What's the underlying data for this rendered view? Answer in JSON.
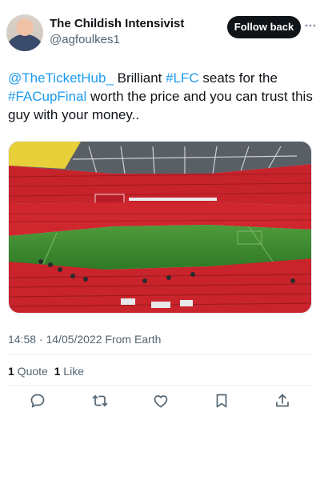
{
  "header": {
    "display_name": "The Childish Intensivist",
    "handle": "@agfoulkes1",
    "follow_label": "Follow back",
    "more_icon": "more-dots-icon"
  },
  "tweet": {
    "mention": "@TheTicketHub_",
    "text_1": " Brilliant ",
    "hashtag_1": "#LFC",
    "text_2": " seats for the ",
    "hashtag_2": "#FACupFinal",
    "text_3": " worth the price and you can trust this guy with your money.."
  },
  "media": {
    "stand_banner": "EMIRATES FA CUP"
  },
  "meta": {
    "timestamp": "14:58 · 14/05/2022 From Earth"
  },
  "stats": {
    "quote_count": "1",
    "quote_label": " Quote",
    "like_count": "1",
    "like_label": " Like"
  },
  "actions": [
    {
      "icon": "reply-icon"
    },
    {
      "icon": "retweet-icon"
    },
    {
      "icon": "like-icon"
    },
    {
      "icon": "bookmark-icon"
    },
    {
      "icon": "share-icon"
    }
  ],
  "colors": {
    "link": "#1d9bf0",
    "text": "#0f1419",
    "muted": "#536471",
    "button": "#0f1419"
  }
}
